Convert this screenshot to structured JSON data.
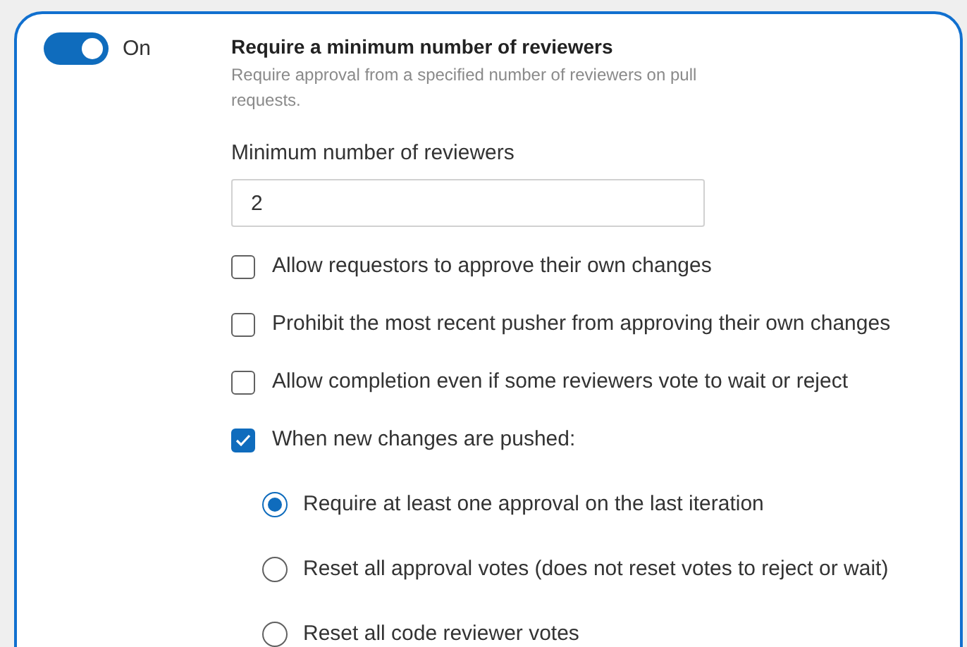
{
  "toggle": {
    "on": true,
    "label": "On"
  },
  "title": "Require a minimum number of reviewers",
  "description": "Require approval from a specified number of reviewers on pull requests.",
  "field": {
    "label": "Minimum number of reviewers",
    "value": "2"
  },
  "options": [
    {
      "kind": "checkbox",
      "label": "Allow requestors to approve their own changes",
      "checked": false
    },
    {
      "kind": "checkbox",
      "label": "Prohibit the most recent pusher from approving their own changes",
      "checked": false
    },
    {
      "kind": "checkbox",
      "label": "Allow completion even if some reviewers vote to wait or reject",
      "checked": false
    },
    {
      "kind": "checkbox",
      "label": "When new changes are pushed:",
      "checked": true
    }
  ],
  "radios": [
    {
      "label": "Require at least one approval on the last iteration",
      "selected": true
    },
    {
      "label": "Reset all approval votes (does not reset votes to reject or wait)",
      "selected": false
    },
    {
      "label": "Reset all code reviewer votes",
      "selected": false
    }
  ]
}
